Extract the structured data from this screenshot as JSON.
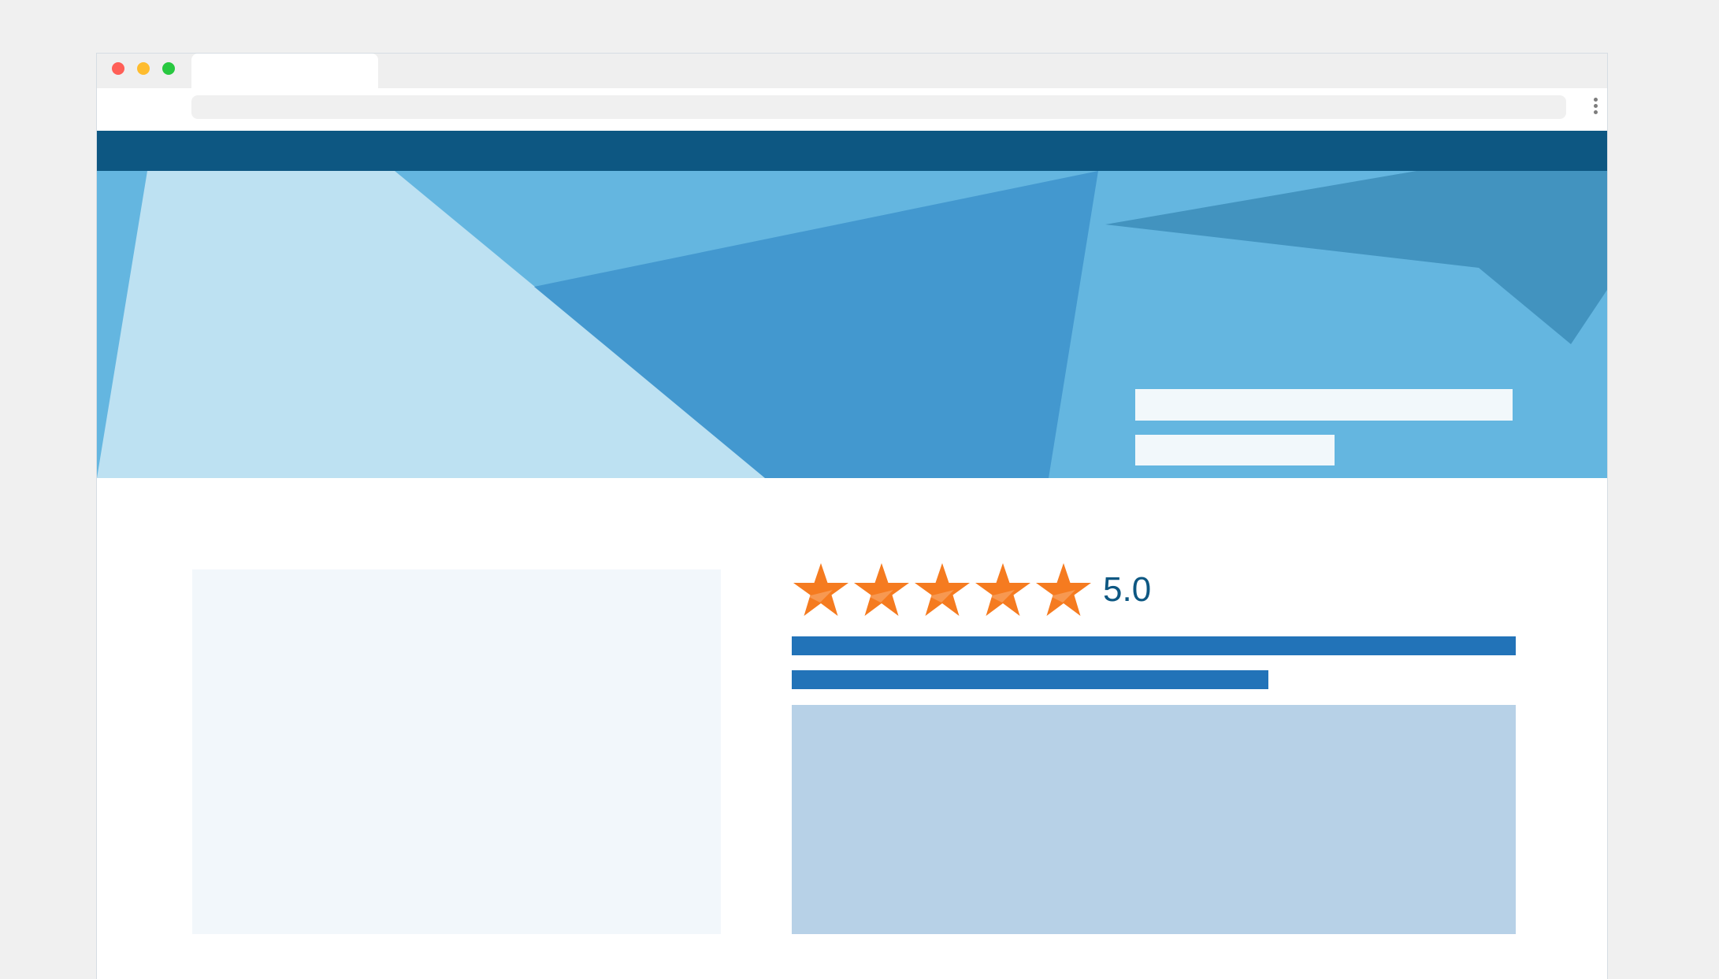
{
  "browser": {
    "window_controls": [
      "close",
      "minimize",
      "maximize"
    ],
    "active_tab_title": "",
    "address_bar_value": "",
    "menu_icon": "kebab-menu-icon"
  },
  "colors": {
    "nav": "#0d5782",
    "hero_light": "#bde1f2",
    "hero_mid": "#64b6e0",
    "hero_dark": "#4398cf",
    "hero_shadow": "#4293bf",
    "star": "#f57b20",
    "title_bars": "#2273b8",
    "description": "#b7d1e7"
  },
  "product": {
    "rating": {
      "value": "5.0",
      "stars_filled": 5,
      "stars_total": 5
    }
  }
}
